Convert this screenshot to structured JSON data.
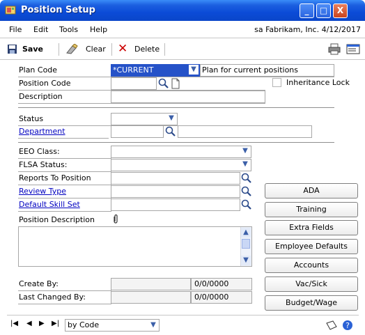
{
  "window": {
    "title": "Position Setup",
    "minimize": "_",
    "maximize": "□",
    "close": "X"
  },
  "menu": {
    "items": [
      "File",
      "Edit",
      "Tools",
      "Help"
    ],
    "status": "sa  Fabrikam, Inc.  4/12/2017"
  },
  "toolbar": {
    "save": "Save",
    "clear": "Clear",
    "delete": "Delete"
  },
  "form": {
    "plan_code": {
      "label": "Plan Code",
      "value": "*CURRENT",
      "description": "Plan for current positions"
    },
    "position_code": {
      "label": "Position Code",
      "value": ""
    },
    "inheritance_lock": {
      "label": "Inheritance Lock",
      "checked": false
    },
    "description": {
      "label": "Description",
      "value": ""
    },
    "status": {
      "label": "Status",
      "value": ""
    },
    "department": {
      "label": "Department",
      "value": "",
      "description": ""
    },
    "eeo_class": {
      "label": "EEO Class:",
      "value": ""
    },
    "flsa_status": {
      "label": "FLSA Status:",
      "value": ""
    },
    "reports_to": {
      "label": "Reports To Position",
      "value": ""
    },
    "review_type": {
      "label": "Review Type",
      "value": ""
    },
    "default_skill_set": {
      "label": "Default Skill Set",
      "value": ""
    },
    "position_description": {
      "label": "Position Description",
      "value": ""
    },
    "create_by": {
      "label": "Create By:",
      "value": "",
      "date": "0/0/0000"
    },
    "last_changed_by": {
      "label": "Last Changed By:",
      "value": "",
      "date": "0/0/0000"
    }
  },
  "buttons": [
    "ADA",
    "Training",
    "Extra Fields",
    "Employee Defaults",
    "Accounts",
    "Vac/Sick",
    "Budget/Wage"
  ],
  "nav": {
    "sort_value": "by Code"
  },
  "colors": {
    "title_bar": "#0b4bd7",
    "link": "#0000c0"
  }
}
